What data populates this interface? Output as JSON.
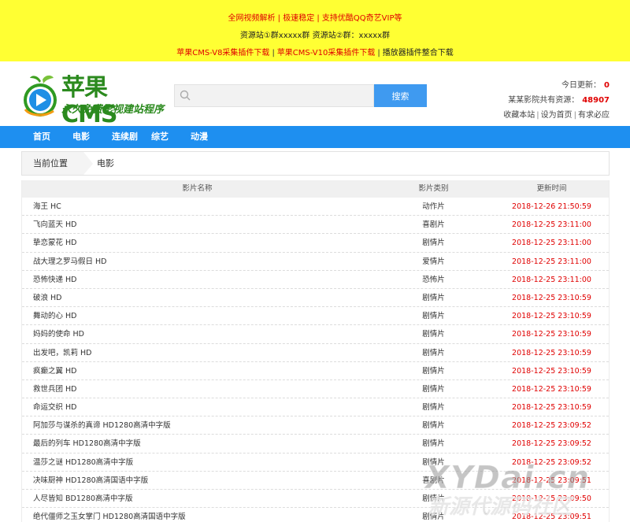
{
  "banner": {
    "line1": "全网视频解析 | 极速稳定 | 支持优酷QQ奇艺VIP等",
    "line2": "资源站①群xxxxx群 资源站②群：xxxxx群",
    "links": [
      "苹果CMS-V8采集插件下载",
      "苹果CMS-V10采集插件下载",
      "播放器插件整合下载"
    ]
  },
  "logo": {
    "main": "苹果CMS",
    "sub": "永久免费影视建站程序"
  },
  "search": {
    "placeholder": "",
    "button": "搜索"
  },
  "stats": {
    "today_label": "今日更新：",
    "today_value": "0",
    "total_label": "某某影院共有资源：",
    "total_value": "48907",
    "links": [
      "收藏本站",
      "设为首页",
      "有求必应"
    ]
  },
  "nav": [
    "首页",
    "电影",
    "连续剧",
    "综艺",
    "动漫"
  ],
  "breadcrumb": {
    "home": "当前位置",
    "current": "电影"
  },
  "table": {
    "headers": [
      "影片名称",
      "影片类别",
      "更新时间"
    ],
    "rows": [
      {
        "name": "海王 HC",
        "type": "动作片",
        "time": "2018-12-26 21:50:59"
      },
      {
        "name": "飞向蓝天 HD",
        "type": "喜剧片",
        "time": "2018-12-25 23:11:00"
      },
      {
        "name": "挚恋蒙花 HD",
        "type": "剧情片",
        "time": "2018-12-25 23:11:00"
      },
      {
        "name": "战大理之罗马假日 HD",
        "type": "爱情片",
        "time": "2018-12-25 23:11:00"
      },
      {
        "name": "恐怖快递 HD",
        "type": "恐怖片",
        "time": "2018-12-25 23:11:00"
      },
      {
        "name": "破浪 HD",
        "type": "剧情片",
        "time": "2018-12-25 23:10:59"
      },
      {
        "name": "舞动的心 HD",
        "type": "剧情片",
        "time": "2018-12-25 23:10:59"
      },
      {
        "name": "妈妈的使命 HD",
        "type": "剧情片",
        "time": "2018-12-25 23:10:59"
      },
      {
        "name": "出发吧，凯莉 HD",
        "type": "剧情片",
        "time": "2018-12-25 23:10:59"
      },
      {
        "name": "疯癫之翼 HD",
        "type": "剧情片",
        "time": "2018-12-25 23:10:59"
      },
      {
        "name": "救世兵团 HD",
        "type": "剧情片",
        "time": "2018-12-25 23:10:59"
      },
      {
        "name": "命运交织 HD",
        "type": "剧情片",
        "time": "2018-12-25 23:10:59"
      },
      {
        "name": "阿加莎与谋杀的真谛 HD1280高清中字版",
        "type": "剧情片",
        "time": "2018-12-25 23:09:52"
      },
      {
        "name": "最后的列车 HD1280高清中字版",
        "type": "剧情片",
        "time": "2018-12-25 23:09:52"
      },
      {
        "name": "温莎之谜 HD1280高清中字版",
        "type": "剧情片",
        "time": "2018-12-25 23:09:52"
      },
      {
        "name": "决味厨神 HD1280高清国语中字版",
        "type": "喜剧片",
        "time": "2018-12-25 23:09:51"
      },
      {
        "name": "人尽皆知 BD1280高清中字版",
        "type": "剧情片",
        "time": "2018-12-25 23:09:50"
      },
      {
        "name": "绝代僵师之玉女掌门 HD1280高清国语中字版",
        "type": "剧情片",
        "time": "2018-12-25 23:09:51"
      }
    ]
  },
  "watermark": {
    "top": "XYDai.cn",
    "bottom": "新源代源码社区"
  },
  "colors": {
    "banner_bg": "#ffff33",
    "nav_bg": "#1e8ff0",
    "button_bg": "#3f9af0",
    "time_red": "#e00000",
    "logo_green": "#2b8a1e"
  }
}
